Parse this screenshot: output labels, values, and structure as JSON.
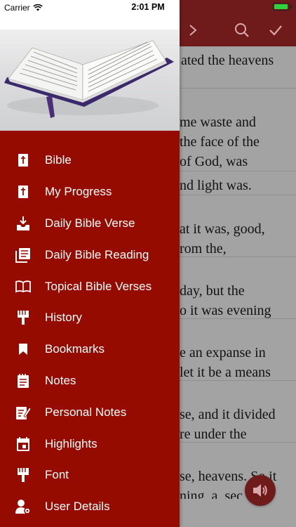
{
  "status_bar": {
    "carrier": "Carrier",
    "time": "2:01 PM",
    "battery_level": 0.95
  },
  "reader": {
    "verses": [
      "ated the heavens",
      "me waste and\nthe face of the\nof God, was\nwaters,",
      "nd light was.",
      "at it was, good,\nrom the,",
      "day, but the\no it was evening\nv.",
      "e an expanse in\nlet it be a means\nand waters,",
      "se, and it divided\nre under the\nwere above the",
      "se, heavens. So it\nning, a, sec"
    ],
    "nav_icons": [
      "chevron-right-icon",
      "search-icon",
      "checkmark-icon"
    ],
    "audio_icon": "speaker-icon"
  },
  "drawer": {
    "header_image": "open-bible-image",
    "menu": [
      {
        "label": "Bible",
        "icon": "bible-book-icon"
      },
      {
        "label": "My Progress",
        "icon": "progress-book-icon"
      },
      {
        "label": "Daily Bible Verse",
        "icon": "download-tray-icon"
      },
      {
        "label": "Daily Bible Reading",
        "icon": "library-books-icon"
      },
      {
        "label": "Topical Bible Verses",
        "icon": "open-book-icon"
      },
      {
        "label": "History",
        "icon": "brush-icon"
      },
      {
        "label": "Bookmarks",
        "icon": "bookmark-icon"
      },
      {
        "label": "Notes",
        "icon": "notepad-icon"
      },
      {
        "label": "Personal Notes",
        "icon": "edit-note-icon"
      },
      {
        "label": "Highlights",
        "icon": "calendar-icon"
      },
      {
        "label": "Font",
        "icon": "brush-icon"
      },
      {
        "label": "User Details",
        "icon": "user-settings-icon"
      }
    ]
  },
  "colors": {
    "drawer_bg": "#950b00",
    "topbar_bg": "#6f1b1b",
    "reader_bg": "#a3a3a3"
  }
}
